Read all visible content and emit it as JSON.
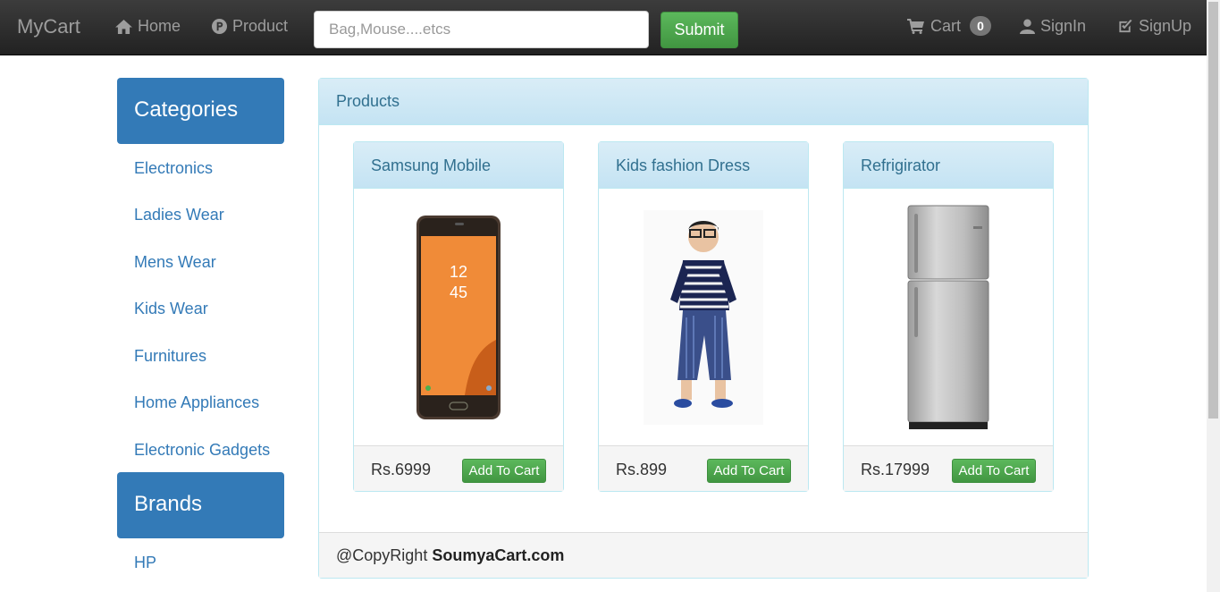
{
  "nav": {
    "brand": "MyCart",
    "home": "Home",
    "product": "Product",
    "search_placeholder": "Bag,Mouse....etcs",
    "submit": "Submit",
    "cart": "Cart",
    "cart_count": "0",
    "signin": "SignIn",
    "signup": "SignUp"
  },
  "sidebar": {
    "categories_title": "Categories",
    "categories": [
      "Electronics",
      "Ladies Wear",
      "Mens Wear",
      "Kids Wear",
      "Furnitures",
      "Home Appliances",
      "Electronic Gadgets"
    ],
    "brands_title": "Brands",
    "brands": [
      "HP"
    ]
  },
  "main": {
    "title": "Products",
    "products": [
      {
        "name": "Samsung Mobile",
        "price": "Rs.6999",
        "button": "Add To Cart"
      },
      {
        "name": "Kids fashion Dress",
        "price": "Rs.899",
        "button": "Add To Cart"
      },
      {
        "name": "Refrigirator",
        "price": "Rs.17999",
        "button": "Add To Cart"
      }
    ],
    "footer_prefix": "@CopyRight",
    "footer_site": "SoumyaCart.com"
  },
  "colors": {
    "primary": "#337ab7",
    "success": "#5cb85c",
    "info_heading": "#31708f"
  }
}
